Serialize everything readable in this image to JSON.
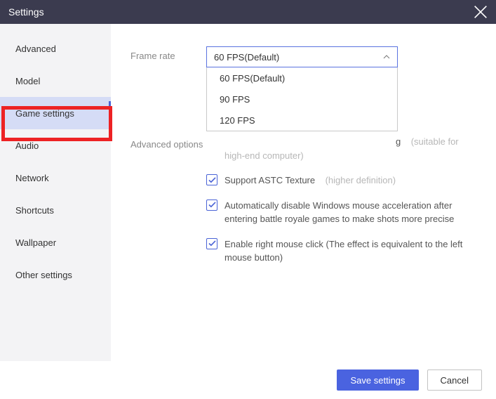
{
  "window": {
    "title": "Settings"
  },
  "sidebar": {
    "items": [
      {
        "label": "Advanced"
      },
      {
        "label": "Model"
      },
      {
        "label": "Game settings"
      },
      {
        "label": "Audio"
      },
      {
        "label": "Network"
      },
      {
        "label": "Shortcuts"
      },
      {
        "label": "Wallpaper"
      },
      {
        "label": "Other settings"
      }
    ],
    "active_index": 2
  },
  "settings": {
    "frame_rate": {
      "label": "Frame rate",
      "selected": "60 FPS(Default)",
      "options": [
        "60 FPS(Default)",
        "90 FPS",
        "120 FPS"
      ]
    },
    "advanced_options": {
      "label": "Advanced options",
      "items": [
        {
          "text_visible_fragment": "g",
          "hint": "(suitable for high-end computer)",
          "checked": true
        },
        {
          "text": "Support ASTC Texture",
          "hint": "(higher definition)",
          "checked": true
        },
        {
          "text": "Automatically disable Windows mouse acceleration after entering battle royale games to make shots more precise",
          "checked": true
        },
        {
          "text": "Enable right mouse click (The effect is equivalent to the left mouse button)",
          "checked": true
        }
      ]
    }
  },
  "footer": {
    "save": "Save settings",
    "cancel": "Cancel"
  }
}
